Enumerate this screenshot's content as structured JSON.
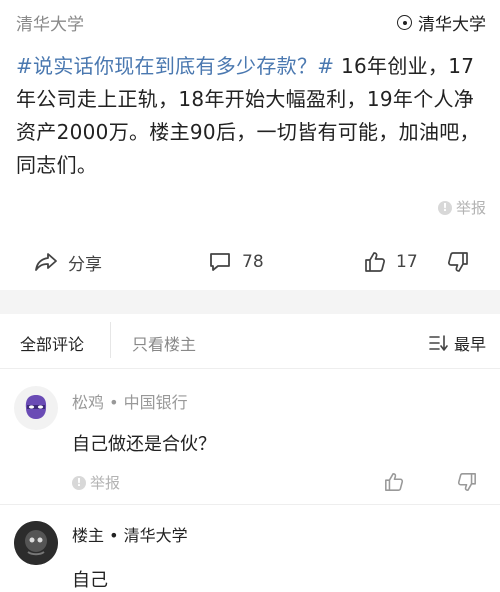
{
  "header": {
    "school": "清华大学",
    "community": "清华大学"
  },
  "post": {
    "hashtag": "#说实话你现在到底有多少存款？#",
    "body": " 16年创业，17年公司走上正轨，18年开始大幅盈利，19年个人净资产2000万。楼主90后，一切皆有可能，加油吧，同志们。",
    "report_label": "举报"
  },
  "actions": {
    "share_label": "分享",
    "comment_count": "78",
    "like_count": "17"
  },
  "tabs": {
    "all_comments": "全部评论",
    "op_only": "只看楼主",
    "sort_label": "最早"
  },
  "comments": [
    {
      "author": "松鸡 • 中国银行",
      "text": "自己做还是合伙？",
      "report_label": "举报"
    },
    {
      "author": "楼主 • 清华大学",
      "text": "自己"
    }
  ],
  "colors": {
    "hashtag": "#4a78b0",
    "muted_text": "#8a8a8a",
    "band": "#f4f4f4",
    "avatar_purple": "#6a4bb5"
  }
}
